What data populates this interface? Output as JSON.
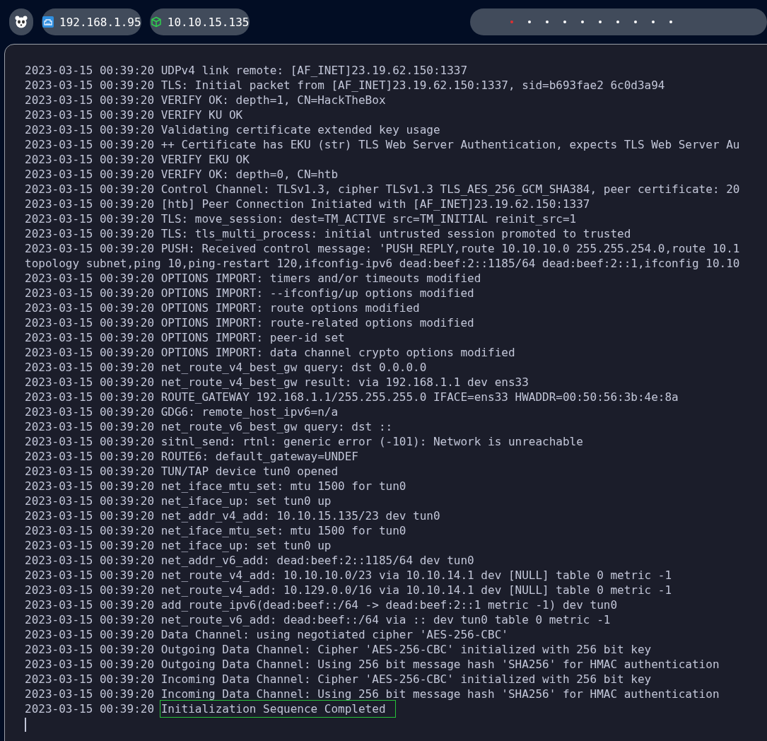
{
  "topbar": {
    "hosts": [
      {
        "kind": "ethernet",
        "label": "192.168.1.95"
      },
      {
        "kind": "vpn",
        "label": "10.10.15.135"
      }
    ],
    "workspaces": [
      {
        "selected": true
      },
      {
        "selected": false
      },
      {
        "selected": false
      },
      {
        "selected": false
      },
      {
        "selected": false
      },
      {
        "selected": false
      },
      {
        "selected": false
      },
      {
        "selected": false
      },
      {
        "selected": false
      },
      {
        "selected": false
      }
    ]
  },
  "terminal": {
    "lines": [
      {
        "timestamp": "2023-03-15 00:39:20",
        "message": "UDPv4 link remote: [AF_INET]23.19.62.150:1337",
        "highlighted": false
      },
      {
        "timestamp": "2023-03-15 00:39:20",
        "message": "TLS: Initial packet from [AF_INET]23.19.62.150:1337, sid=b693fae2 6c0d3a94",
        "highlighted": false
      },
      {
        "timestamp": "2023-03-15 00:39:20",
        "message": "VERIFY OK: depth=1, CN=HackTheBox",
        "highlighted": false
      },
      {
        "timestamp": "2023-03-15 00:39:20",
        "message": "VERIFY KU OK",
        "highlighted": false
      },
      {
        "timestamp": "2023-03-15 00:39:20",
        "message": "Validating certificate extended key usage",
        "highlighted": false
      },
      {
        "timestamp": "2023-03-15 00:39:20",
        "message": "++ Certificate has EKU (str) TLS Web Server Authentication, expects TLS Web Server Au",
        "highlighted": false
      },
      {
        "timestamp": "2023-03-15 00:39:20",
        "message": "VERIFY EKU OK",
        "highlighted": false
      },
      {
        "timestamp": "2023-03-15 00:39:20",
        "message": "VERIFY OK: depth=0, CN=htb",
        "highlighted": false
      },
      {
        "timestamp": "2023-03-15 00:39:20",
        "message": "Control Channel: TLSv1.3, cipher TLSv1.3 TLS_AES_256_GCM_SHA384, peer certificate: 20",
        "highlighted": false
      },
      {
        "timestamp": "2023-03-15 00:39:20",
        "message": "[htb] Peer Connection Initiated with [AF_INET]23.19.62.150:1337",
        "highlighted": false
      },
      {
        "timestamp": "2023-03-15 00:39:20",
        "message": "TLS: move_session: dest=TM_ACTIVE src=TM_INITIAL reinit_src=1",
        "highlighted": false
      },
      {
        "timestamp": "2023-03-15 00:39:20",
        "message": "TLS: tls_multi_process: initial untrusted session promoted to trusted",
        "highlighted": false
      },
      {
        "timestamp": "2023-03-15 00:39:20",
        "message": "PUSH: Received control message: 'PUSH_REPLY,route 10.10.10.0 255.255.254.0,route 10.1",
        "highlighted": false
      },
      {
        "message": "topology subnet,ping 10,ping-restart 120,ifconfig-ipv6 dead:beef:2::1185/64 dead:beef:2::1,ifconfig 10.10",
        "highlighted": false
      },
      {
        "timestamp": "2023-03-15 00:39:20",
        "message": "OPTIONS IMPORT: timers and/or timeouts modified",
        "highlighted": false
      },
      {
        "timestamp": "2023-03-15 00:39:20",
        "message": "OPTIONS IMPORT: --ifconfig/up options modified",
        "highlighted": false
      },
      {
        "timestamp": "2023-03-15 00:39:20",
        "message": "OPTIONS IMPORT: route options modified",
        "highlighted": false
      },
      {
        "timestamp": "2023-03-15 00:39:20",
        "message": "OPTIONS IMPORT: route-related options modified",
        "highlighted": false
      },
      {
        "timestamp": "2023-03-15 00:39:20",
        "message": "OPTIONS IMPORT: peer-id set",
        "highlighted": false
      },
      {
        "timestamp": "2023-03-15 00:39:20",
        "message": "OPTIONS IMPORT: data channel crypto options modified",
        "highlighted": false
      },
      {
        "timestamp": "2023-03-15 00:39:20",
        "message": "net_route_v4_best_gw query: dst 0.0.0.0",
        "highlighted": false
      },
      {
        "timestamp": "2023-03-15 00:39:20",
        "message": "net_route_v4_best_gw result: via 192.168.1.1 dev ens33",
        "highlighted": false
      },
      {
        "timestamp": "2023-03-15 00:39:20",
        "message": "ROUTE_GATEWAY 192.168.1.1/255.255.255.0 IFACE=ens33 HWADDR=00:50:56:3b:4e:8a",
        "highlighted": false
      },
      {
        "timestamp": "2023-03-15 00:39:20",
        "message": "GDG6: remote_host_ipv6=n/a",
        "highlighted": false
      },
      {
        "timestamp": "2023-03-15 00:39:20",
        "message": "net_route_v6_best_gw query: dst ::",
        "highlighted": false
      },
      {
        "timestamp": "2023-03-15 00:39:20",
        "message": "sitnl_send: rtnl: generic error (-101): Network is unreachable",
        "highlighted": false
      },
      {
        "timestamp": "2023-03-15 00:39:20",
        "message": "ROUTE6: default_gateway=UNDEF",
        "highlighted": false
      },
      {
        "timestamp": "2023-03-15 00:39:20",
        "message": "TUN/TAP device tun0 opened",
        "highlighted": false
      },
      {
        "timestamp": "2023-03-15 00:39:20",
        "message": "net_iface_mtu_set: mtu 1500 for tun0",
        "highlighted": false
      },
      {
        "timestamp": "2023-03-15 00:39:20",
        "message": "net_iface_up: set tun0 up",
        "highlighted": false
      },
      {
        "timestamp": "2023-03-15 00:39:20",
        "message": "net_addr_v4_add: 10.10.15.135/23 dev tun0",
        "highlighted": false
      },
      {
        "timestamp": "2023-03-15 00:39:20",
        "message": "net_iface_mtu_set: mtu 1500 for tun0",
        "highlighted": false
      },
      {
        "timestamp": "2023-03-15 00:39:20",
        "message": "net_iface_up: set tun0 up",
        "highlighted": false
      },
      {
        "timestamp": "2023-03-15 00:39:20",
        "message": "net_addr_v6_add: dead:beef:2::1185/64 dev tun0",
        "highlighted": false
      },
      {
        "timestamp": "2023-03-15 00:39:20",
        "message": "net_route_v4_add: 10.10.10.0/23 via 10.10.14.1 dev [NULL] table 0 metric -1",
        "highlighted": false
      },
      {
        "timestamp": "2023-03-15 00:39:20",
        "message": "net_route_v4_add: 10.129.0.0/16 via 10.10.14.1 dev [NULL] table 0 metric -1",
        "highlighted": false
      },
      {
        "timestamp": "2023-03-15 00:39:20",
        "message": "add_route_ipv6(dead:beef::/64 -> dead:beef:2::1 metric -1) dev tun0",
        "highlighted": false
      },
      {
        "timestamp": "2023-03-15 00:39:20",
        "message": "net_route_v6_add: dead:beef::/64 via :: dev tun0 table 0 metric -1",
        "highlighted": false
      },
      {
        "timestamp": "2023-03-15 00:39:20",
        "message": "Data Channel: using negotiated cipher 'AES-256-CBC'",
        "highlighted": false
      },
      {
        "timestamp": "2023-03-15 00:39:20",
        "message": "Outgoing Data Channel: Cipher 'AES-256-CBC' initialized with 256 bit key",
        "highlighted": false
      },
      {
        "timestamp": "2023-03-15 00:39:20",
        "message": "Outgoing Data Channel: Using 256 bit message hash 'SHA256' for HMAC authentication",
        "highlighted": false
      },
      {
        "timestamp": "2023-03-15 00:39:20",
        "message": "Incoming Data Channel: Cipher 'AES-256-CBC' initialized with 256 bit key",
        "highlighted": false
      },
      {
        "timestamp": "2023-03-15 00:39:20",
        "message": "Incoming Data Channel: Using 256 bit message hash 'SHA256' for HMAC authentication",
        "highlighted": false
      },
      {
        "timestamp": "2023-03-15 00:39:20",
        "message": "Initialization Sequence Completed",
        "highlighted": true
      }
    ]
  }
}
